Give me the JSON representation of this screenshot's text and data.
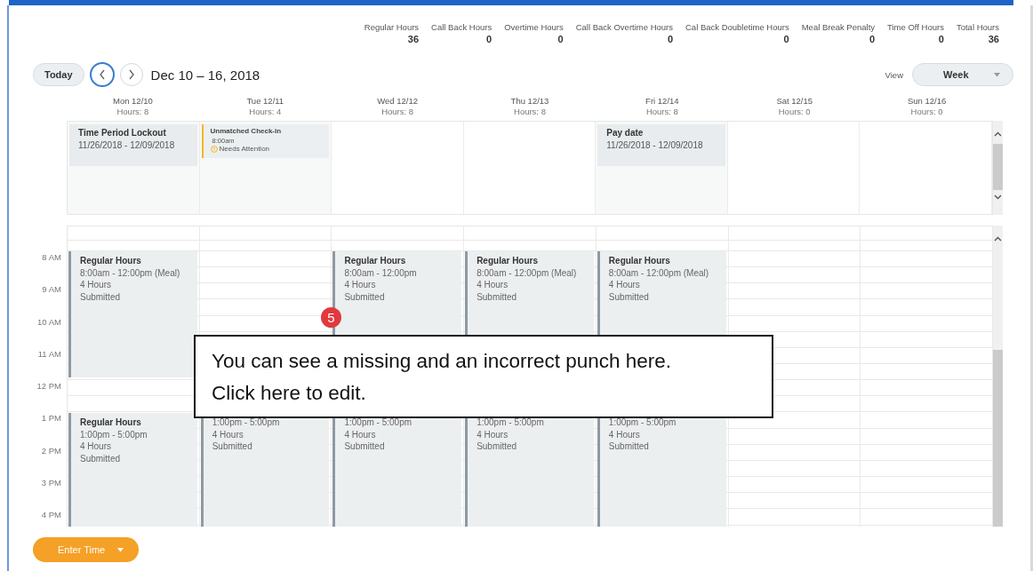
{
  "summary": [
    {
      "label": "Regular Hours",
      "value": "36"
    },
    {
      "label": "Call Back Hours",
      "value": "0"
    },
    {
      "label": "Overtime Hours",
      "value": "0"
    },
    {
      "label": "Call Back Overtime Hours",
      "value": "0"
    },
    {
      "label": "Cal Back Doubletime Hours",
      "value": "0"
    },
    {
      "label": "Meal Break Penalty",
      "value": "0"
    },
    {
      "label": "Time Off Hours",
      "value": "0"
    },
    {
      "label": "Total Hours",
      "value": "36"
    }
  ],
  "toolbar": {
    "today": "Today",
    "nav": [
      {
        "kind": "prev",
        "focused": true
      },
      {
        "kind": "next",
        "focused": false
      }
    ],
    "date_range": "Dec 10 – 16, 2018",
    "view_label": "View",
    "view_value": "Week"
  },
  "hours": [
    "8 AM",
    "9 AM",
    "10 AM",
    "11 AM",
    "12 PM",
    "1 PM",
    "2 PM",
    "3 PM",
    "4 PM"
  ],
  "days": [
    {
      "label": "Mon 12/10",
      "hours": "Hours: 8",
      "all_day": [
        {
          "kind": "block",
          "title": "Time Period Lockout",
          "dates": "11/26/2018 - 12/09/2018"
        }
      ],
      "events": [
        {
          "kind": "morning",
          "title": "Regular Hours",
          "time": "8:00am - 12:00pm (Meal)",
          "duration": "4 Hours",
          "status": "Submitted"
        },
        {
          "kind": "afternoon",
          "title": "Regular Hours",
          "time": "1:00pm - 5:00pm",
          "duration": "4 Hours",
          "status": "Submitted"
        }
      ]
    },
    {
      "label": "Tue 12/11",
      "hours": "Hours: 4",
      "all_day": [
        {
          "kind": "alert",
          "title": "Unmatched Check-in",
          "time": "8:00am",
          "status": "Needs Attention"
        }
      ],
      "events": [
        {
          "kind": "afternoon",
          "time": "1:00pm - 5:00pm",
          "duration": "4 Hours",
          "status": "Submitted"
        }
      ]
    },
    {
      "label": "Wed 12/12",
      "hours": "Hours: 8",
      "events": [
        {
          "kind": "morning",
          "title": "Regular Hours",
          "time": "8:00am - 12:00pm",
          "duration": "4 Hours",
          "status": "Submitted"
        },
        {
          "kind": "afternoon",
          "time": "1:00pm - 5:00pm",
          "duration": "4 Hours",
          "status": "Submitted"
        }
      ]
    },
    {
      "label": "Thu 12/13",
      "hours": "Hours: 8",
      "events": [
        {
          "kind": "morning",
          "title": "Regular Hours",
          "time": "8:00am - 12:00pm (Meal)",
          "duration": "4 Hours",
          "status": "Submitted"
        },
        {
          "kind": "afternoon",
          "time": "1:00pm - 5:00pm",
          "duration": "4 Hours",
          "status": "Submitted"
        }
      ]
    },
    {
      "label": "Fri 12/14",
      "hours": "Hours: 8",
      "all_day": [
        {
          "kind": "block",
          "title": "Pay date",
          "dates": "11/26/2018 - 12/09/2018"
        }
      ],
      "events": [
        {
          "kind": "morning",
          "title": "Regular Hours",
          "time": "8:00am - 12:00pm (Meal)",
          "duration": "4 Hours",
          "status": "Submitted"
        },
        {
          "kind": "afternoon",
          "time": "1:00pm - 5:00pm",
          "duration": "4 Hours",
          "status": "Submitted"
        }
      ]
    },
    {
      "label": "Sat 12/15",
      "hours": "Hours: 0"
    },
    {
      "label": "Sun 12/16",
      "hours": "Hours: 0"
    }
  ],
  "callout": {
    "badge": "5",
    "lines": [
      "You can see a missing and an incorrect punch here.",
      "Click here to edit."
    ]
  },
  "footer": {
    "button": "Enter Time"
  }
}
